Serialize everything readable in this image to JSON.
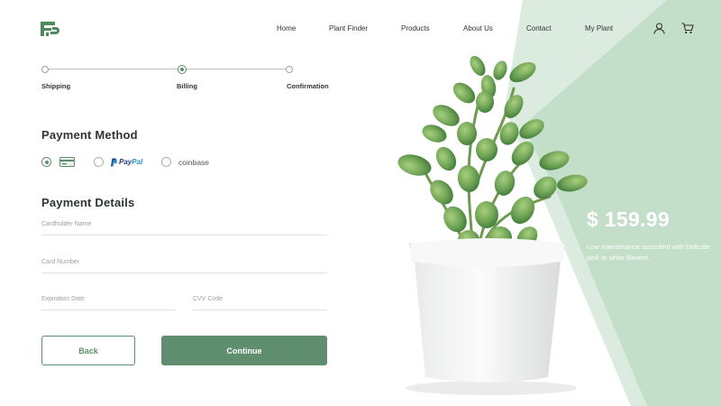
{
  "brand": {
    "logo": "logo-icon"
  },
  "nav": {
    "items": [
      {
        "label": "Home"
      },
      {
        "label": "Plant Finder"
      },
      {
        "label": "Products"
      },
      {
        "label": "About Us"
      },
      {
        "label": "Contact"
      },
      {
        "label": "My Plant"
      }
    ],
    "icons": [
      "user-icon",
      "cart-icon"
    ]
  },
  "stepper": {
    "steps": [
      {
        "label": "Shipping",
        "state": "completed"
      },
      {
        "label": "Billing",
        "state": "active"
      },
      {
        "label": "Confirmation",
        "state": "upcoming"
      }
    ]
  },
  "payment_method": {
    "title": "Payment Method",
    "options": [
      {
        "name": "card",
        "icon": "credit-card-icon",
        "selected": true
      },
      {
        "name": "paypal",
        "label_part1": "Pay",
        "label_part2": "Pal",
        "selected": false
      },
      {
        "name": "coinbase",
        "label": "coinbase",
        "selected": false
      }
    ]
  },
  "payment_details": {
    "title": "Payment Details",
    "fields": {
      "cardholder_name": {
        "placeholder": "Cardholder Name",
        "value": ""
      },
      "card_number": {
        "placeholder": "Card Number",
        "value": ""
      },
      "expiration_date": {
        "placeholder": "Expiration Date",
        "value": ""
      },
      "cvv": {
        "placeholder": "CVV Code",
        "value": ""
      }
    }
  },
  "actions": {
    "back_label": "Back",
    "continue_label": "Continue"
  },
  "product": {
    "price": "$ 159.99",
    "description": "Low maintenance succulent with Delicate pink or white flowers."
  },
  "colors": {
    "accent": "#5e8e6d",
    "panel_green": "#c7e0cc",
    "panel_green_light": "#dcebdf"
  }
}
